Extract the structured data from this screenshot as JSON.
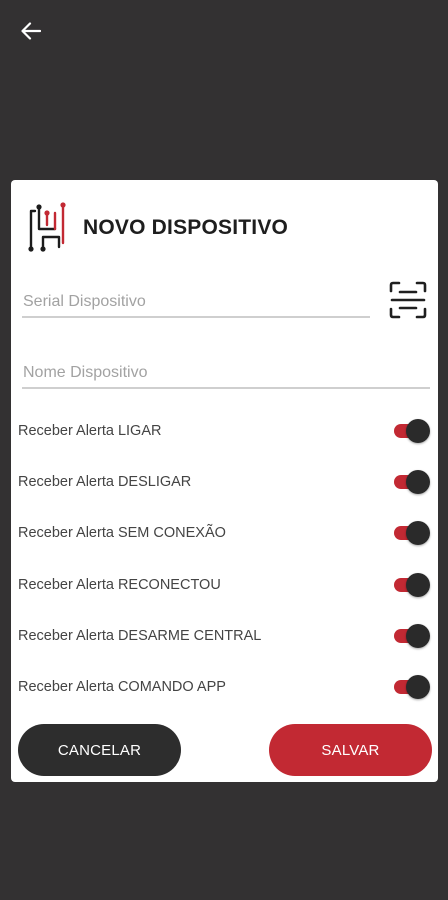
{
  "topbar": {
    "back_icon": "arrow-left-icon"
  },
  "dialog": {
    "logo_icon": "circuit-h-logo",
    "title": "NOVO DISPOSITIVO",
    "serial_placeholder": "Serial Dispositivo",
    "serial_value": "",
    "nome_placeholder": "Nome Dispositivo",
    "nome_value": "",
    "scan_icon": "qr-scan-icon",
    "alerts": [
      {
        "label": "Receber Alerta LIGAR",
        "on": true
      },
      {
        "label": "Receber Alerta DESLIGAR",
        "on": true
      },
      {
        "label": "Receber Alerta SEM CONEXÃO",
        "on": true
      },
      {
        "label": "Receber Alerta RECONECTOU",
        "on": true
      },
      {
        "label": "Receber Alerta DESARME CENTRAL",
        "on": true
      },
      {
        "label": "Receber Alerta COMANDO APP",
        "on": true
      }
    ],
    "cancel_label": "CANCELAR",
    "save_label": "SALVAR"
  },
  "colors": {
    "background": "#333132",
    "accent": "#c22933",
    "dark_button": "#2d2d2d",
    "dialog": "#ffffff"
  }
}
